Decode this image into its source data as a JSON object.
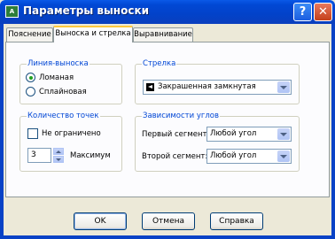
{
  "window": {
    "title": "Параметры выноски",
    "icon_name": "autocad-icon",
    "help_label": "?",
    "close_label": "✕"
  },
  "tabs": [
    {
      "label": "Пояснение",
      "active": false
    },
    {
      "label": "Выноска и стрелка",
      "active": true
    },
    {
      "label": "Выравнивание",
      "active": false
    }
  ],
  "leader_line": {
    "title": "Линия-выноска",
    "options": [
      {
        "label": "Ломаная",
        "selected": true
      },
      {
        "label": "Сплайновая",
        "selected": false
      }
    ]
  },
  "points": {
    "title": "Количество точек",
    "unlimited_label": "Не ограничено",
    "unlimited_checked": false,
    "max_value": "3",
    "max_label": "Максимум"
  },
  "arrow": {
    "title": "Стрелка",
    "selected": "Закрашенная замкнутая",
    "icon_name": "closed-filled-arrow-icon"
  },
  "angles": {
    "title": "Зависимости углов",
    "first_label": "Первый сегмент:",
    "first_value": "Любой угол",
    "second_label": "Второй сегмент:",
    "second_value": "Любой угол"
  },
  "buttons": {
    "ok": "OK",
    "cancel": "Отмена",
    "help": "Справка"
  },
  "colors": {
    "titlebar": "#0A59E8",
    "group_title": "#0046D5",
    "radio_dot": "#21A121",
    "tab_highlight": "#FFC83C"
  }
}
